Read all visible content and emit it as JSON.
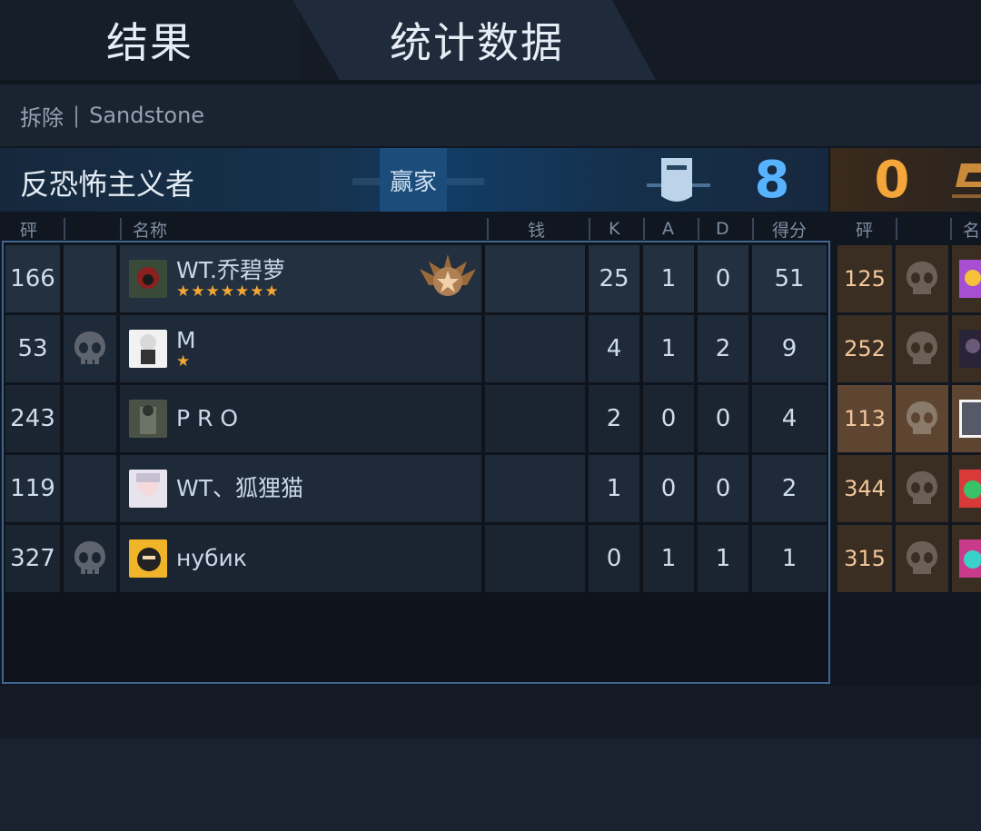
{
  "tabs": {
    "result": "结果",
    "stats": "统计数据"
  },
  "match": {
    "mode": "拆除",
    "separator": "|",
    "map": "Sandstone"
  },
  "banner": {
    "team": "反恐怖主义者",
    "winner_label": "赢家",
    "score_ct": "8",
    "score_t": "0"
  },
  "columns": {
    "rank": "砰",
    "name": "名称",
    "money": "钱",
    "k": "K",
    "a": "A",
    "d": "D",
    "score": "得分"
  },
  "opp_columns": {
    "rank": "砰",
    "name": "名"
  },
  "players": [
    {
      "rank": "166",
      "dead": false,
      "name": "WT.乔碧萝",
      "stars": "★★★★★★★",
      "has_medal": true,
      "k": "25",
      "a": "1",
      "d": "0",
      "score": "51"
    },
    {
      "rank": "53",
      "dead": true,
      "name": "M",
      "stars": "★",
      "has_medal": false,
      "k": "4",
      "a": "1",
      "d": "2",
      "score": "9"
    },
    {
      "rank": "243",
      "dead": false,
      "name": "P R O",
      "stars": "",
      "has_medal": false,
      "k": "2",
      "a": "0",
      "d": "0",
      "score": "4"
    },
    {
      "rank": "119",
      "dead": false,
      "name": "WT、狐狸猫",
      "stars": "",
      "has_medal": false,
      "k": "1",
      "a": "0",
      "d": "0",
      "score": "2"
    },
    {
      "rank": "327",
      "dead": true,
      "name": "нубик",
      "stars": "",
      "has_medal": false,
      "k": "0",
      "a": "1",
      "d": "1",
      "score": "1"
    }
  ],
  "opponents": [
    {
      "rank": "125",
      "dead": true
    },
    {
      "rank": "252",
      "dead": true
    },
    {
      "rank": "113",
      "dead": true
    },
    {
      "rank": "344",
      "dead": true
    },
    {
      "rank": "315",
      "dead": true
    }
  ],
  "colors": {
    "ct_score": "#58b3ff",
    "t_score": "#f4a63a",
    "star": "#f3a633",
    "panel_border": "#3e6690"
  },
  "icons": {
    "dead": "skull-icon",
    "ct_team": "riot-shield-icon",
    "t_team": "t-team-icon",
    "mvp": "star-medal-icon"
  }
}
